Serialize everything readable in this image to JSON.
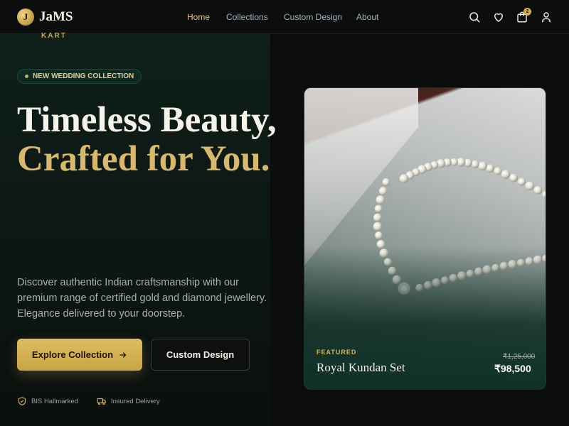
{
  "brand": {
    "initial": "J",
    "name": "JaMS",
    "sub": "KART"
  },
  "nav": {
    "items": [
      "Home",
      "Collections",
      "Custom Design",
      "About"
    ],
    "active": "Home"
  },
  "header_icons": {
    "search": "search-icon",
    "wishlist": "heart-icon",
    "cart": "shopping-bag-icon",
    "cart_count": "2",
    "account": "user-icon"
  },
  "hero": {
    "badge": "NEW WEDDING COLLECTION",
    "headline_line1": "Timeless Beauty,",
    "headline_line2": "Crafted for You.",
    "description": "Discover authentic Indian craftsmanship with our premium range of certified gold and diamond jewellery. Elegance delivered to your doorstep.",
    "primary_cta": "Explore Collection",
    "secondary_cta": "Custom Design",
    "trust": [
      {
        "icon": "shield-check-icon",
        "label": "BIS Hallmarked"
      },
      {
        "icon": "truck-icon",
        "label": "Insured Delivery"
      }
    ]
  },
  "featured_product": {
    "tag": "FEATURED",
    "name": "Royal Kundan Set",
    "old_price": "₹1,25,000",
    "price": "₹98,500"
  },
  "colors": {
    "accent": "#d4af50",
    "background": "#0b0c0c",
    "pill_bg": "#0f2a20"
  }
}
